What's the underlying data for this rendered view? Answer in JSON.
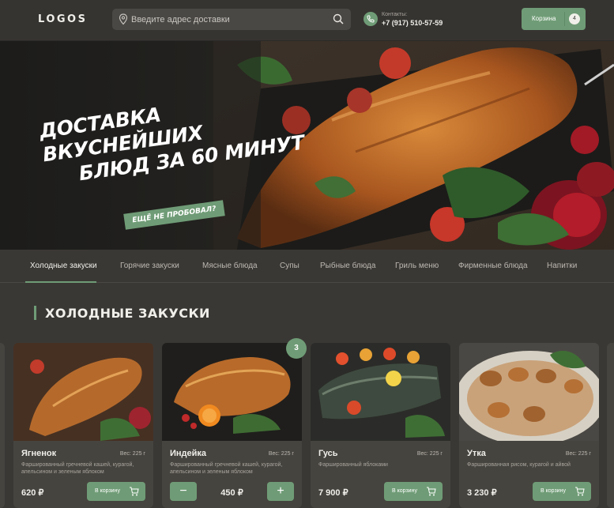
{
  "header": {
    "logo": "LOGOS",
    "search_placeholder": "Введите адрес доставки",
    "contacts_label": "Контакты:",
    "phone": "+7 (917) 510-57-59",
    "cart_label": "Корзина",
    "cart_count": "4"
  },
  "hero": {
    "title_line1": "Доставка вкуснейших",
    "title_line2": "блюд за 60 минут",
    "tag": "Ещё не пробовал?"
  },
  "categories": [
    {
      "label": "Холодные закуски",
      "active": true
    },
    {
      "label": "Горячие закуски"
    },
    {
      "label": "Мясные блюда"
    },
    {
      "label": "Супы"
    },
    {
      "label": "Рыбные блюда"
    },
    {
      "label": "Гриль меню"
    },
    {
      "label": "Фирменные блюда"
    },
    {
      "label": "Напитки"
    }
  ],
  "section_title": "Холодные закуски",
  "products": [
    {
      "name": "Ягненок",
      "weight": "Вес: 225 г",
      "desc": "Фаршированный гречневой кашей, курагой, апельсином и зеленым яблоком",
      "price": "620 ₽",
      "button": "В корзину"
    },
    {
      "name": "Индейка",
      "weight": "Вес: 225 г",
      "desc": "Фаршированный гречневой кашей, курагой, апельсином и зеленым яблоком",
      "price": "450 ₽",
      "quantity_badge": "3",
      "minus": "−",
      "plus": "+"
    },
    {
      "name": "Гусь",
      "weight": "Вес: 225 г",
      "desc": "Фаршированный яблоками",
      "price": "7 900 ₽",
      "button": "В корзину"
    },
    {
      "name": "Утка",
      "weight": "Вес: 225 г",
      "desc": "Фаршированная рисом, курагой и айвой",
      "price": "3 230 ₽",
      "button": "В корзину"
    }
  ],
  "colors": {
    "accent": "#6f9c76",
    "background": "#3a3835",
    "card": "#46443f"
  }
}
